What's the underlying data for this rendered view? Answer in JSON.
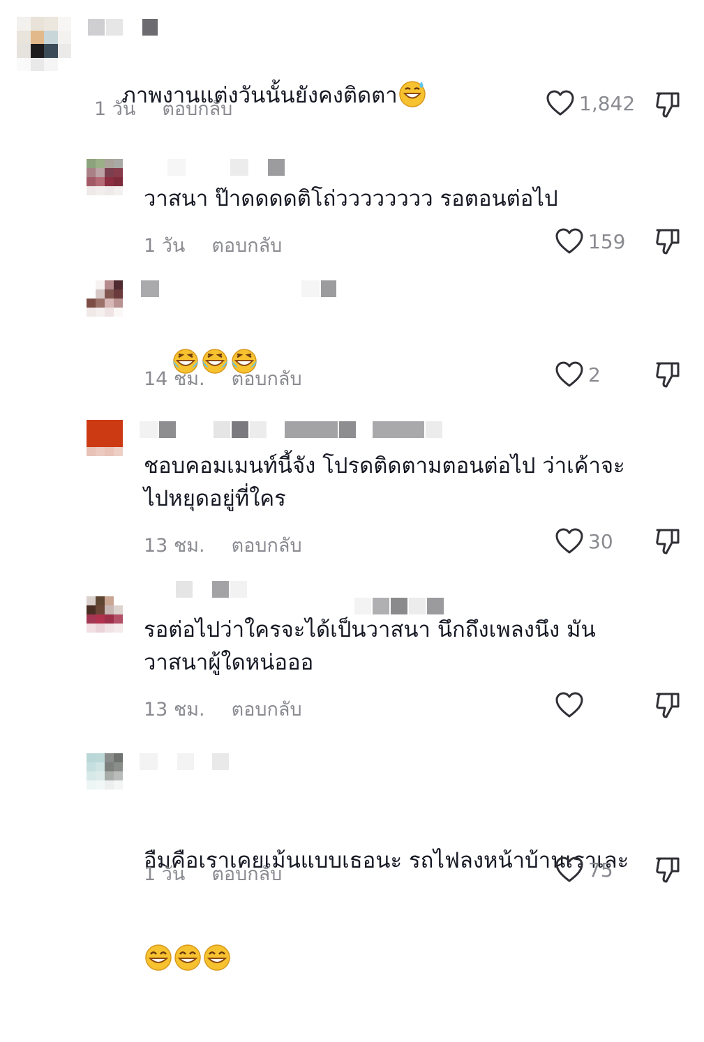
{
  "comments": [
    {
      "text": "ภาพงานแต่งวันนั้นยังคงติดตา",
      "emoji": "sweat-smile",
      "time": "1 วัน",
      "reply": "ตอบกลับ",
      "likes": "1,842"
    },
    {
      "text": "วาสนา ป๊าดดดดติโถ่วววววววว รอตอนต่อไป",
      "time": "1 วัน",
      "reply": "ตอบกลับ",
      "likes": "159"
    },
    {
      "text": "",
      "emoji": "tears-of-joy",
      "time": "14 ชม.",
      "reply": "ตอบกลับ",
      "likes": "2"
    },
    {
      "text": "ชอบคอมเมนท์นี้จัง โปรดติดตามตอนต่อไป ว่าเค้าจะ\nไปหยุดอยู่ที่ใคร",
      "time": "13 ชม.",
      "reply": "ตอบกลับ",
      "likes": "30"
    },
    {
      "text": "รอต่อไปว่าใครจะได้เป็นวาสนา นึกถึงเพลงนึง มัน\nวาสนาผู้ใดหน่อออ",
      "time": "13 ชม.",
      "reply": "ตอบกลับ",
      "likes": ""
    },
    {
      "text": "อืมคือเราเคยเม้นแบบเธอนะ รถไฟลงหน้าบ้านเราเละ",
      "emoji": "grin",
      "time": "1 วัน",
      "reply": "ตอบกลับ",
      "likes": "75"
    }
  ],
  "icons": {
    "like": "heart-outline-icon",
    "dislike": "thumbs-down-outline-icon"
  },
  "colors": {
    "text": "#161823",
    "meta": "#8a8b91",
    "icon": "#2f2f35"
  }
}
